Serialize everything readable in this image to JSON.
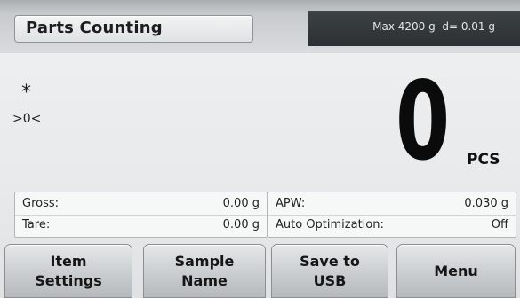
{
  "header": {
    "app_title": "Parts Counting",
    "capacity": "Max 4200 g  d= 0.01 g"
  },
  "indicators": {
    "stable": "*",
    "center_zero": ">0<"
  },
  "display": {
    "value": "0",
    "unit": "PCS"
  },
  "info_left": [
    {
      "label": "Gross:",
      "value": "0.00 g"
    },
    {
      "label": "Tare:",
      "value": "0.00 g"
    }
  ],
  "info_right": [
    {
      "label": "APW:",
      "value": "0.030 g"
    },
    {
      "label": "Auto Optimization:",
      "value": "Off"
    }
  ],
  "buttons": {
    "item_settings": "Item\nSettings",
    "sample_name": "Sample\nName",
    "save_usb": "Save to\nUSB",
    "menu": "Menu"
  },
  "colors": {
    "header_capacity_bg": "#2f3336",
    "background": "#e8eaeb",
    "text": "#111111"
  }
}
